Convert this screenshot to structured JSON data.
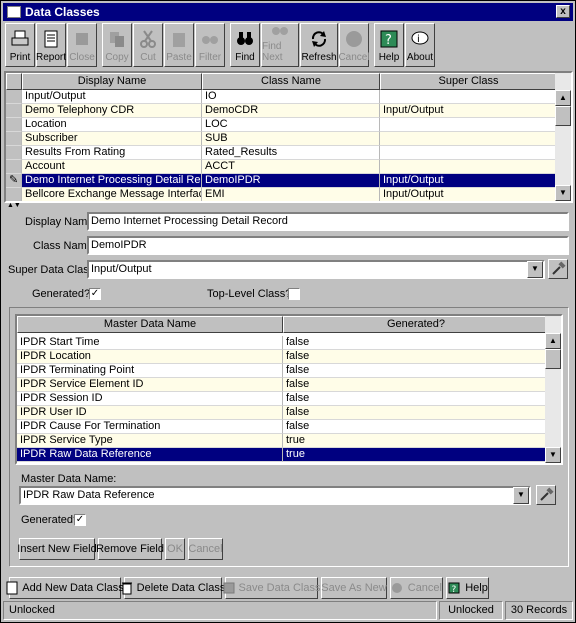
{
  "window": {
    "title": "Data Classes",
    "close_label": "x"
  },
  "toolbar": [
    {
      "label": "Print",
      "icon": "print-icon",
      "enabled": true
    },
    {
      "label": "Report",
      "icon": "report-icon",
      "enabled": true
    },
    {
      "label": "Close",
      "icon": "close-doc-icon",
      "enabled": false
    },
    {
      "label": "Copy",
      "icon": "copy-icon",
      "enabled": false
    },
    {
      "label": "Cut",
      "icon": "cut-icon",
      "enabled": false
    },
    {
      "label": "Paste",
      "icon": "paste-icon",
      "enabled": false
    },
    {
      "label": "Filter",
      "icon": "filter-icon",
      "enabled": false
    },
    {
      "label": "Find",
      "icon": "binoculars-icon",
      "enabled": true
    },
    {
      "label": "Find Next",
      "icon": "find-next-icon",
      "enabled": false
    },
    {
      "label": "Refresh",
      "icon": "refresh-icon",
      "enabled": true
    },
    {
      "label": "Cancel",
      "icon": "cancel-icon",
      "enabled": false
    },
    {
      "label": "Help",
      "icon": "help-icon",
      "enabled": true
    },
    {
      "label": "About",
      "icon": "about-icon",
      "enabled": true
    }
  ],
  "classes_table": {
    "headers": [
      "Display Name",
      "Class Name",
      "Super Class"
    ],
    "rows": [
      [
        "Input/Output",
        "IO",
        ""
      ],
      [
        "Demo Telephony CDR",
        "DemoCDR",
        "Input/Output"
      ],
      [
        "Location",
        "LOC",
        ""
      ],
      [
        "Subscriber",
        "SUB",
        ""
      ],
      [
        "Results From Rating",
        "Rated_Results",
        ""
      ],
      [
        "Account",
        "ACCT",
        ""
      ],
      [
        "Demo Internet Processing Detail Record",
        "DemoIPDR",
        "Input/Output"
      ],
      [
        "Bellcore Exchange Message Interface",
        "EMI",
        "Input/Output"
      ]
    ],
    "selected_index": 6
  },
  "form": {
    "display_name_label": "Display Name:",
    "display_name_value": "Demo Internet Processing Detail Record",
    "class_name_label": "Class Name:",
    "class_name_value": "DemoIPDR",
    "super_class_label": "Super Data Class:",
    "super_class_value": "Input/Output",
    "generated_label": "Generated?:",
    "generated_checked": "✓",
    "top_level_label": "Top-Level Class?:",
    "top_level_checked": ""
  },
  "master_table": {
    "headers": [
      "Master Data Name",
      "Generated?"
    ],
    "rows": [
      [
        "IPDR Start Time",
        "false"
      ],
      [
        "IPDR Location",
        "false"
      ],
      [
        "IPDR Terminating Point",
        "false"
      ],
      [
        "IPDR Service Element ID",
        "false"
      ],
      [
        "IPDR Session ID",
        "false"
      ],
      [
        "IPDR User ID",
        "false"
      ],
      [
        "IPDR Cause For Termination",
        "false"
      ],
      [
        "IPDR Service Type",
        "true"
      ],
      [
        "IPDR Raw Data Reference",
        "true"
      ]
    ],
    "selected_index": 8
  },
  "field_form": {
    "master_name_label": "Master Data Name:",
    "master_name_value": "IPDR Raw Data Reference",
    "generated_label": "Generated?",
    "generated_checked": "✓",
    "insert_label": "Insert New Field",
    "remove_label": "Remove Field",
    "ok_label": "OK",
    "cancel_label": "Cancel"
  },
  "bottom_buttons": {
    "add": "Add New Data Class",
    "delete": "Delete Data Class",
    "save": "Save Data Class",
    "save_as": "Save As New",
    "cancel": "Cancel",
    "help": "Help"
  },
  "status": {
    "left": "Unlocked",
    "mid": "Unlocked",
    "right": "30 Records"
  },
  "colors": {
    "selection": "#000080",
    "row_tint": "#fffde8",
    "face": "#c0c0c0"
  }
}
